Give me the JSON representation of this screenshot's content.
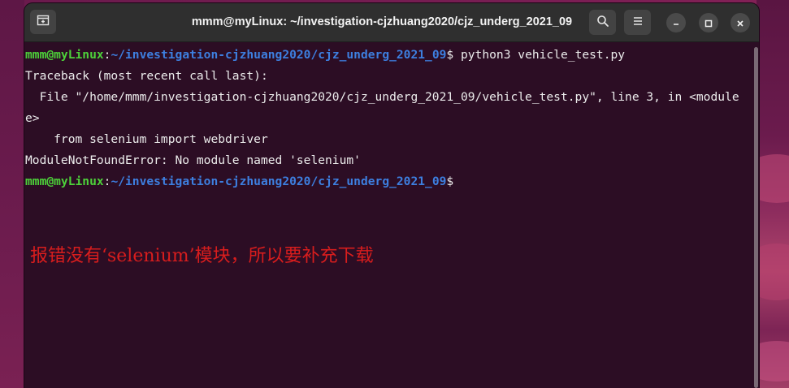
{
  "window": {
    "title": "mmm@myLinux: ~/investigation-cjzhuang2020/cjz_underg_2021_09"
  },
  "icons": {
    "new_tab": "new-tab-icon",
    "search": "search-icon",
    "menu": "hamburger-menu-icon",
    "minimize": "minimize-icon",
    "maximize": "maximize-icon",
    "close": "close-icon"
  },
  "terminal": {
    "prompt_user": "mmm@myLinux",
    "prompt_colon": ":",
    "prompt_path": "~/investigation-cjzhuang2020/cjz_underg_2021_09",
    "prompt_symbol": "$",
    "command": " python3 vehicle_test.py",
    "output": [
      "Traceback (most recent call last):",
      "  File \"/home/mmm/investigation-cjzhuang2020/cjz_underg_2021_09/vehicle_test.py\", line 3, in <module",
      "e>",
      "    from selenium import webdriver",
      "ModuleNotFoundError: No module named 'selenium'"
    ]
  },
  "annotation": {
    "text": "报错没有‘selenium’模块，所以要补充下载",
    "color": "#d81d1d"
  },
  "colors": {
    "terminal_bg": "#2c0d24",
    "prompt_user": "#4dd23a",
    "prompt_path": "#3d7fe0",
    "titlebar_bg": "#2f2f2f"
  }
}
